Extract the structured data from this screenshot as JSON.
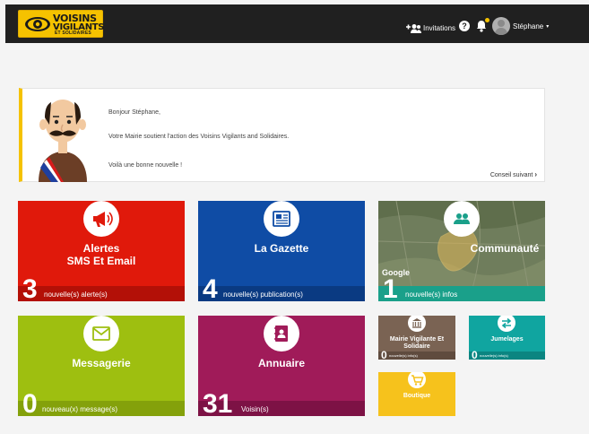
{
  "header": {
    "logo_line1": "VOISINS",
    "logo_line2": "VIGILANTS",
    "logo_line3": "ET SOLIDAIRES",
    "invitations_label": "Invitations",
    "help_label": "?",
    "user_name": "Stéphane",
    "user_menu_caret": "▾"
  },
  "welcome": {
    "line1": "Bonjour Stéphane,",
    "line2": "Votre Mairie soutient l'action des Voisins Vigilants and Solidaires.",
    "line3": "Voilà une bonne nouvelle !",
    "next_label": "Conseil suivant",
    "next_arrow": "›"
  },
  "tiles": {
    "alertes": {
      "title_line1": "Alertes",
      "title_line2": "SMS Et Email",
      "count": "3",
      "footer": "nouvelle(s) alerte(s)",
      "icon": "megaphone-icon"
    },
    "gazette": {
      "title": "La Gazette",
      "count": "4",
      "footer": "nouvelle(s) publication(s)",
      "icon": "newspaper-icon"
    },
    "communaute": {
      "title": "Communauté",
      "count": "1",
      "footer": "nouvelle(s) infos",
      "map_credit": "Google",
      "icon": "people-icon"
    },
    "messagerie": {
      "title": "Messagerie",
      "count": "0",
      "footer": "nouveau(x) message(s)",
      "icon": "envelope-icon"
    },
    "annuaire": {
      "title": "Annuaire",
      "count": "31",
      "footer": "Voisin(s)",
      "icon": "contact-book-icon"
    },
    "mairie": {
      "title_line1": "Mairie Vigilante Et",
      "title_line2": "Solidaire",
      "count": "0",
      "footer": "nouvelle(s) info(s)",
      "icon": "town-hall-icon"
    },
    "jumelages": {
      "title": "Jumelages",
      "count": "0",
      "footer": "nouvelle(s) info(s)",
      "icon": "swap-arrows-icon"
    },
    "boutique": {
      "title": "Boutique",
      "icon": "cart-icon"
    }
  },
  "colors": {
    "brand_yellow": "#f5c200",
    "alertes": "#e0190b",
    "gazette": "#0f4ca5",
    "communaute_footer": "#1aa08a",
    "messagerie": "#9ebf10",
    "annuaire": "#a01b59",
    "mairie": "#7a6353",
    "jumelages": "#10a5a0",
    "boutique": "#f6c21c"
  }
}
